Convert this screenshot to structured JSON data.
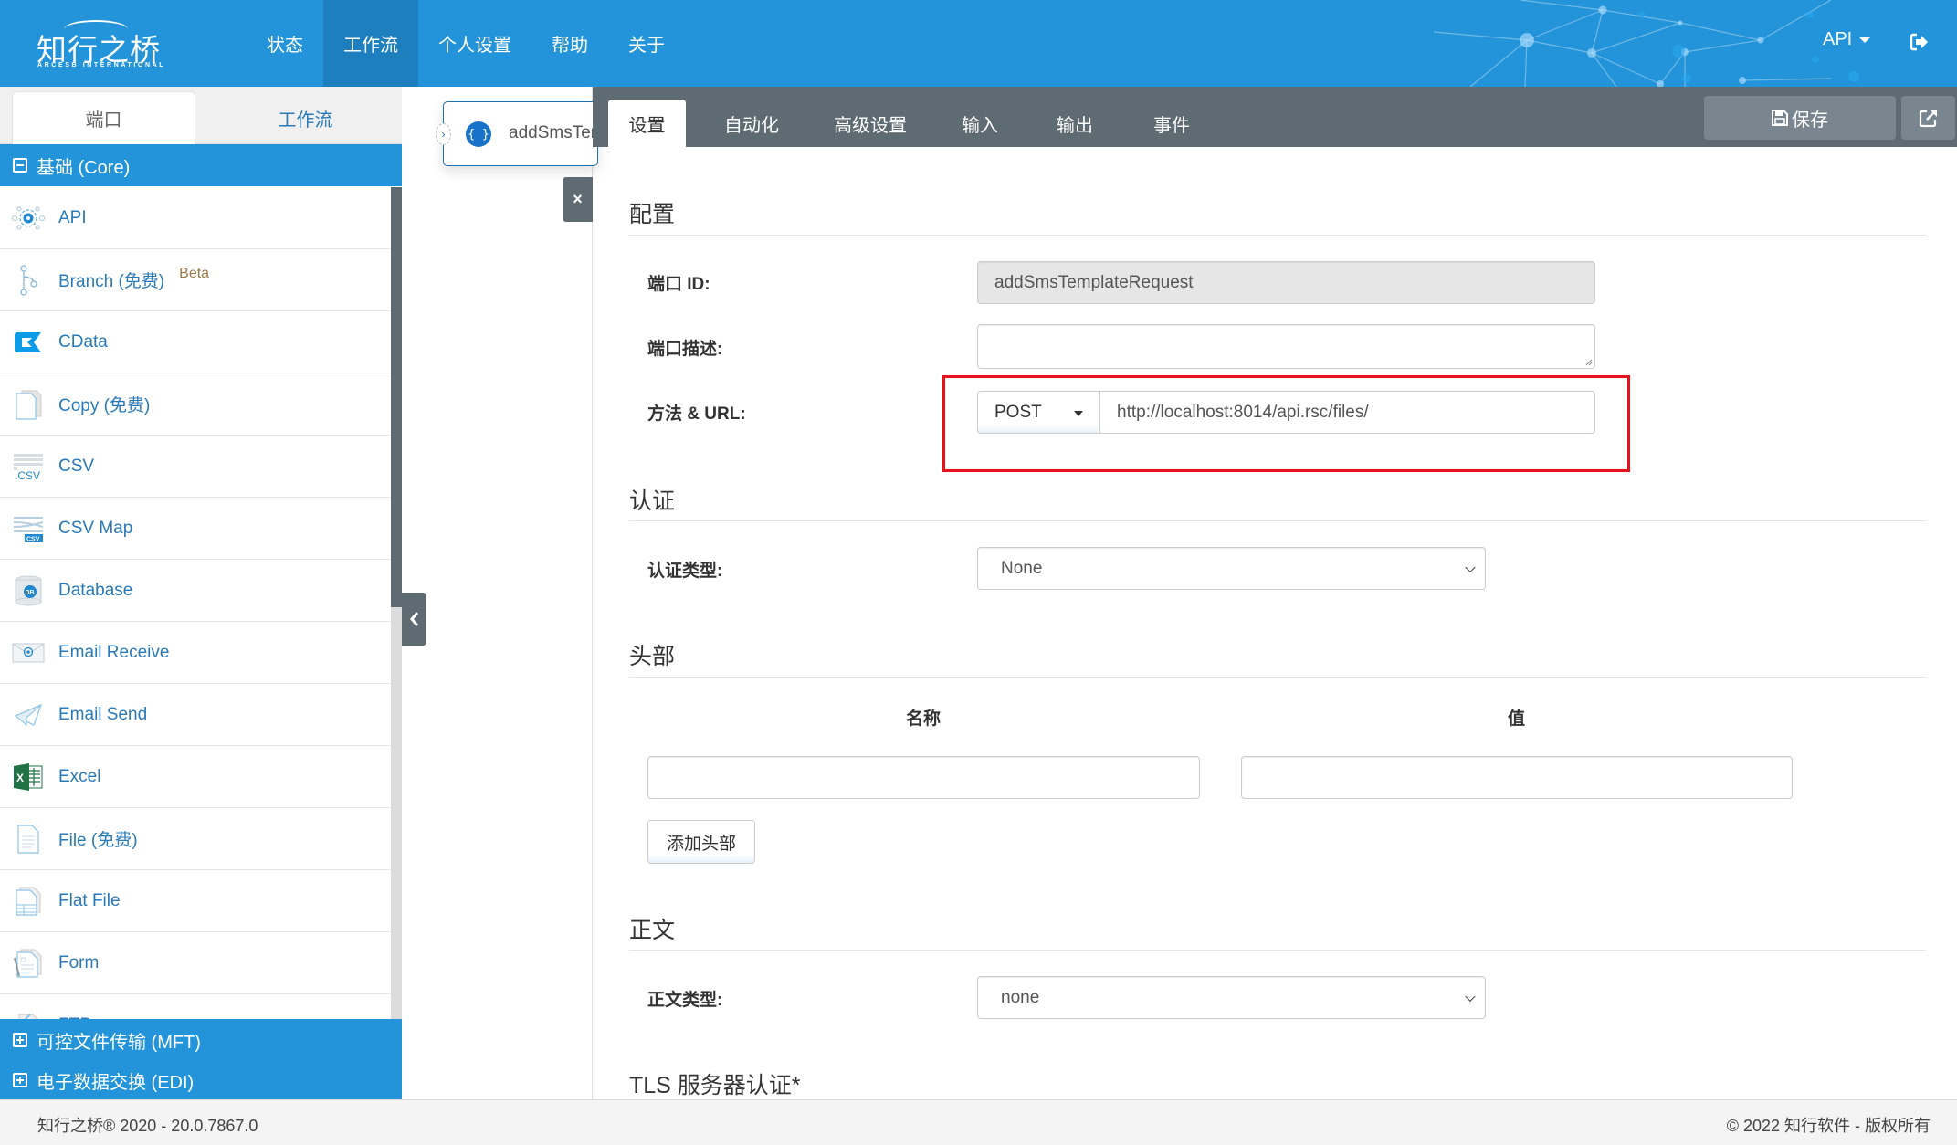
{
  "header": {
    "logo_text": "知行之桥",
    "logo_subtext": "ARCESB INTERNATIONAL",
    "nav": [
      {
        "label": "状态",
        "active": false
      },
      {
        "label": "工作流",
        "active": true
      },
      {
        "label": "个人设置",
        "active": false
      },
      {
        "label": "帮助",
        "active": false
      },
      {
        "label": "关于",
        "active": false
      }
    ],
    "user_menu_label": "API",
    "logout_icon": "sign-out-icon"
  },
  "sidebar": {
    "tabs": [
      {
        "label": "端口",
        "active": true
      },
      {
        "label": "工作流",
        "active": false
      }
    ],
    "groups": [
      {
        "label": "基础 (Core)",
        "expanded": true,
        "icon": "minus-square-icon"
      },
      {
        "label": "可控文件传输 (MFT)",
        "expanded": false,
        "icon": "plus-square-icon"
      },
      {
        "label": "电子数据交换 (EDI)",
        "expanded": false,
        "icon": "plus-square-icon"
      }
    ],
    "items": [
      {
        "label": "API",
        "icon": "api-gear-icon"
      },
      {
        "label": "Branch (免费)",
        "icon": "branch-icon",
        "badge": "Beta"
      },
      {
        "label": "CData",
        "icon": "cdata-logo-icon"
      },
      {
        "label": "Copy (免费)",
        "icon": "copy-icon"
      },
      {
        "label": "CSV",
        "icon": "csv-icon"
      },
      {
        "label": "CSV Map",
        "icon": "csv-map-icon"
      },
      {
        "label": "Database",
        "icon": "database-icon"
      },
      {
        "label": "Email Receive",
        "icon": "email-receive-icon"
      },
      {
        "label": "Email Send",
        "icon": "paper-plane-icon"
      },
      {
        "label": "Excel",
        "icon": "excel-icon"
      },
      {
        "label": "File (免费)",
        "icon": "file-icon"
      },
      {
        "label": "Flat File",
        "icon": "flat-file-icon"
      },
      {
        "label": "Form",
        "icon": "form-icon"
      },
      {
        "label": "FTP",
        "icon": "ftp-icon"
      }
    ]
  },
  "canvas": {
    "node_name": "addSmsTemplateRequest",
    "node_icon": "curly-braces-icon",
    "close_label": "×"
  },
  "editor": {
    "tabs": [
      {
        "label": "设置",
        "active": true
      },
      {
        "label": "自动化",
        "active": false
      },
      {
        "label": "高级设置",
        "active": false
      },
      {
        "label": "输入",
        "active": false
      },
      {
        "label": "输出",
        "active": false
      },
      {
        "label": "事件",
        "active": false
      }
    ],
    "save_label": "保存",
    "save_icon": "floppy-disk-icon",
    "external_icon": "external-link-icon",
    "sections": {
      "config": {
        "title": "配置",
        "port_id_label": "端口 ID:",
        "port_id_value": "addSmsTemplateRequest",
        "desc_label": "端口描述:",
        "desc_value": "",
        "method_url_label": "方法 & URL:",
        "method_value": "POST",
        "url_value": "http://localhost:8014/api.rsc/files/"
      },
      "auth": {
        "title": "认证",
        "type_label": "认证类型:",
        "type_value": "None"
      },
      "headers": {
        "title": "头部",
        "name_col": "名称",
        "value_col": "值",
        "name_value": "",
        "value_value": "",
        "add_label": "添加头部"
      },
      "body": {
        "title": "正文",
        "type_label": "正文类型:",
        "type_value": "none"
      },
      "tls": {
        "title": "TLS 服务器认证*"
      }
    }
  },
  "footer": {
    "version": "知行之桥® 2020 - 20.0.7867.0",
    "copyright": "© 2022 知行软件 - 版权所有"
  },
  "colors": {
    "brand_blue": "#2394d9",
    "nav_active": "#1e7fbf",
    "toolbar_gray": "#5f6b73",
    "link_blue": "#2a7ab8",
    "highlight_red": "#e8101a"
  }
}
